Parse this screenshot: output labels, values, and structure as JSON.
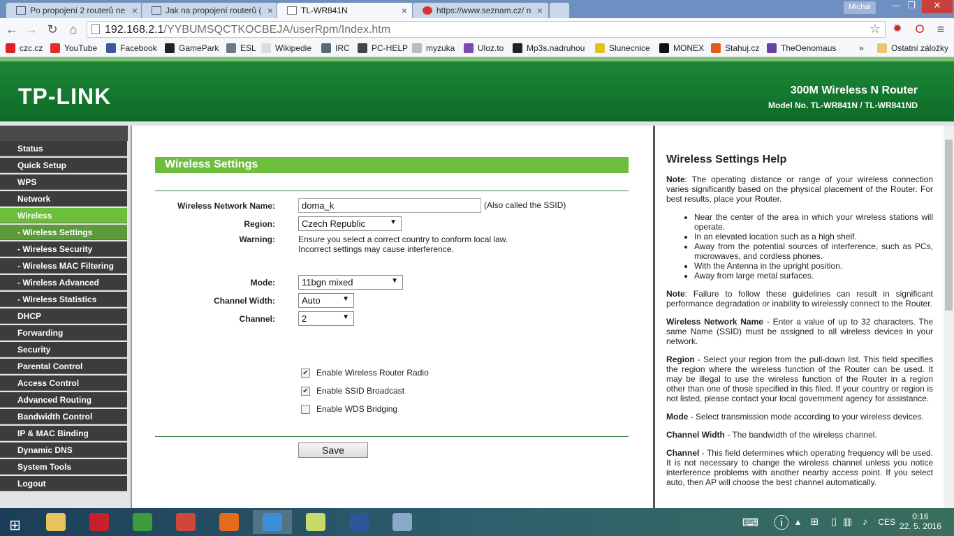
{
  "browser": {
    "tabs": [
      {
        "title": "Po propojení 2 routerů ne",
        "close": "×"
      },
      {
        "title": "Jak na propojení routerů (",
        "close": "×"
      },
      {
        "title": "TL-WR841N",
        "close": "×"
      },
      {
        "title": "https://www.seznam.cz/ n",
        "close": "×"
      }
    ],
    "user": "Michal",
    "window_controls": {
      "minimize": "—",
      "restore": "❐",
      "close": "✕"
    },
    "url_host": "192.168.2.1",
    "url_path": "/YYBUMSQCTKOCBEJA/userRpm/Index.htm",
    "bookmarks": [
      {
        "label": "czc.cz",
        "color": "#d22"
      },
      {
        "label": "YouTube",
        "color": "#e52d27"
      },
      {
        "label": "Facebook",
        "color": "#3b5998"
      },
      {
        "label": "GamePark",
        "color": "#222"
      },
      {
        "label": "ESL",
        "color": "#6a7a8a"
      },
      {
        "label": "Wikipedie",
        "color": "#ddd"
      },
      {
        "label": "IRC",
        "color": "#5a6a7a"
      },
      {
        "label": "PC-HELP",
        "color": "#444"
      },
      {
        "label": "myzuka",
        "color": "#bbb"
      },
      {
        "label": "Uloz.to",
        "color": "#7a4ab0"
      },
      {
        "label": "Mp3s.nadruhou",
        "color": "#222"
      },
      {
        "label": "Slunecnice",
        "color": "#e8c21a"
      },
      {
        "label": "MONEX",
        "color": "#111"
      },
      {
        "label": "Stahuj.cz",
        "color": "#e45b1a"
      },
      {
        "label": "TheOenomaus",
        "color": "#6441a5"
      }
    ],
    "more_bookmarks": "»",
    "other_bookmarks": "Ostatní záložky"
  },
  "router": {
    "logo": "TP-LINK",
    "product": "300M Wireless N Router",
    "model": "Model No. TL-WR841N / TL-WR841ND"
  },
  "menu": [
    {
      "label": "Status",
      "sub": false,
      "active": false
    },
    {
      "label": "Quick Setup",
      "sub": false,
      "active": false
    },
    {
      "label": "WPS",
      "sub": false,
      "active": false
    },
    {
      "label": "Network",
      "sub": false,
      "active": false
    },
    {
      "label": "Wireless",
      "sub": false,
      "active": true
    },
    {
      "label": "- Wireless Settings",
      "sub": true,
      "active": true
    },
    {
      "label": "- Wireless Security",
      "sub": true,
      "active": false
    },
    {
      "label": "- Wireless MAC Filtering",
      "sub": true,
      "active": false
    },
    {
      "label": "- Wireless Advanced",
      "sub": true,
      "active": false
    },
    {
      "label": "- Wireless Statistics",
      "sub": true,
      "active": false
    },
    {
      "label": "DHCP",
      "sub": false,
      "active": false
    },
    {
      "label": "Forwarding",
      "sub": false,
      "active": false
    },
    {
      "label": "Security",
      "sub": false,
      "active": false
    },
    {
      "label": "Parental Control",
      "sub": false,
      "active": false
    },
    {
      "label": "Access Control",
      "sub": false,
      "active": false
    },
    {
      "label": "Advanced Routing",
      "sub": false,
      "active": false
    },
    {
      "label": "Bandwidth Control",
      "sub": false,
      "active": false
    },
    {
      "label": "IP & MAC Binding",
      "sub": false,
      "active": false
    },
    {
      "label": "Dynamic DNS",
      "sub": false,
      "active": false
    },
    {
      "label": "System Tools",
      "sub": false,
      "active": false
    },
    {
      "label": "Logout",
      "sub": false,
      "active": false
    }
  ],
  "form": {
    "title": "Wireless Settings",
    "ssid_label": "Wireless Network Name:",
    "ssid_value": "doma_k",
    "ssid_note": "(Also called the SSID)",
    "region_label": "Region:",
    "region_value": "Czech Republic",
    "warning_label": "Warning:",
    "warning_line1": "Ensure you select a correct country to conform local law.",
    "warning_line2": "Incorrect settings may cause interference.",
    "mode_label": "Mode:",
    "mode_value": "11bgn mixed",
    "width_label": "Channel Width:",
    "width_value": "Auto",
    "channel_label": "Channel:",
    "channel_value": "2",
    "radio_label": "Enable Wireless Router Radio",
    "radio_checked": true,
    "ssid_broadcast_label": "Enable SSID Broadcast",
    "ssid_broadcast_checked": true,
    "wds_label": "Enable WDS Bridging",
    "wds_checked": false,
    "save": "Save"
  },
  "help": {
    "title": "Wireless Settings Help",
    "note1_label": "Note",
    "note1": ": The operating distance or range of your wireless connection varies significantly based on the physical placement of the Router. For best results, place your Router.",
    "bullets": [
      "Near the center of the area in which your wireless stations will operate.",
      "In an elevated location such as a high shelf.",
      "Away from the potential sources of interference, such as PCs, microwaves, and cordless phones.",
      "With the Antenna in the upright position.",
      "Away from large metal surfaces."
    ],
    "note2_label": "Note",
    "note2": ": Failure to follow these guidelines can result in significant performance degradation or inability to wirelessly connect to the Router.",
    "name_label": "Wireless Network Name",
    "name_text": " - Enter a value of up to 32 characters. The same Name (SSID) must be assigned to all wireless devices in your network.",
    "region_label": "Region",
    "region_text": " - Select your region from the pull-down list. This field specifies the region where the wireless function of the Router can be used. It may be illegal to use the wireless function of the Router in a region other than one of those specified in this filed. If your country or region is not listed, please contact your local government agency for assistance.",
    "mode_label": "Mode",
    "mode_text": " - Select transmission mode according to your wireless devices.",
    "width_label": "Channel Width",
    "width_text": " - The bandwidth of the wireless channel.",
    "channel_label": "Channel",
    "channel_text": " - This field determines which operating frequency will be used. It is not necessary to change the wireless channel unless you notice interference problems with another nearby access point. If you select auto, then AP will choose the best channel automatically."
  },
  "taskbar": {
    "lang": "CES",
    "time": "0:16",
    "date": "22. 5. 2016",
    "apps": [
      {
        "name": "file-explorer",
        "color": "#e8c25a"
      },
      {
        "name": "flash-app",
        "color": "#c8202a"
      },
      {
        "name": "utorrent",
        "color": "#3d9a3d"
      },
      {
        "name": "ccleaner",
        "color": "#d0463a"
      },
      {
        "name": "firefox",
        "color": "#e66b1f"
      },
      {
        "name": "chrome",
        "color": "#3a8fd8"
      },
      {
        "name": "sticky-notes",
        "color": "#c9d96a"
      },
      {
        "name": "word",
        "color": "#2b579a"
      },
      {
        "name": "paint",
        "color": "#8aa9c9"
      }
    ]
  }
}
